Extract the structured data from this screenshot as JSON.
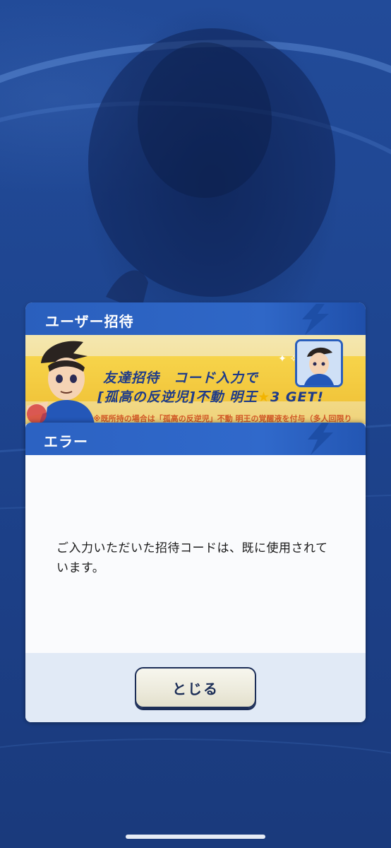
{
  "invite_panel": {
    "title": "ユーザー招待",
    "banner": {
      "line1": "友達招待　コード入力で",
      "line2_prefix": "[孤高の反逆児]不動 明王",
      "line2_star": "★",
      "line2_suffix": "3 GET!",
      "subtext": "※既所持の場合は「孤高の反逆児」不動 明王の覚醒液を付与（多人回限り"
    }
  },
  "error_dialog": {
    "title": "エラー",
    "message": "ご入力いただいた招待コードは、既に使用されています。",
    "close_label": "とじる"
  },
  "colors": {
    "header_blue": "#2c62c2",
    "background": "#1b3f86",
    "banner_yellow": "#f7d44a",
    "button_border": "#1c2e57"
  }
}
